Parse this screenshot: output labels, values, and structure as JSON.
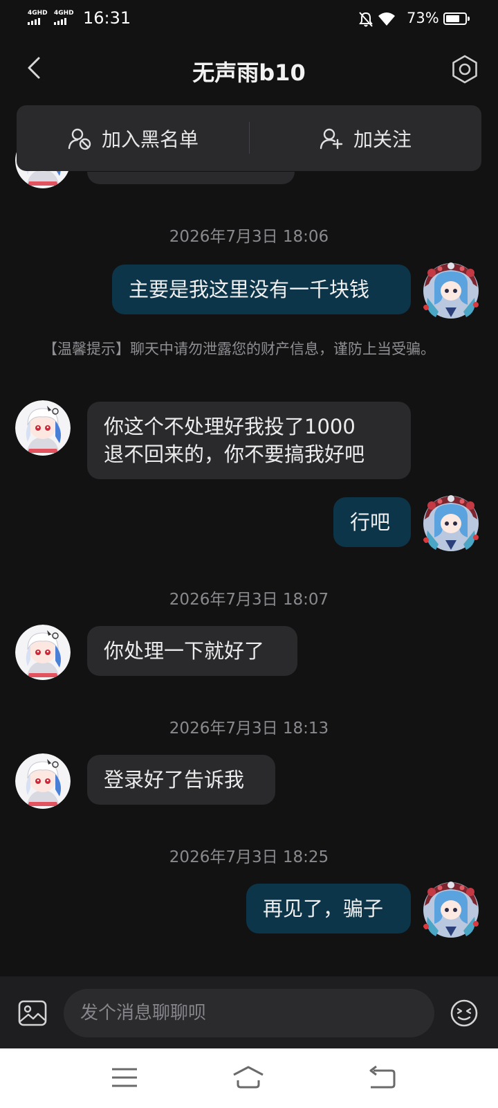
{
  "status_bar": {
    "network_1": "4GHD",
    "network_2": "4GHD",
    "time": "16:31",
    "battery_percent": "73%",
    "battery_level": 0.73,
    "icons": [
      "mute-icon",
      "wifi-icon",
      "battery-icon"
    ]
  },
  "header": {
    "title": "无声雨b10",
    "icons": [
      "back-arrow-icon",
      "settings-hexagon-icon"
    ]
  },
  "actions": {
    "blacklist_label": "加入黑名单",
    "follow_label": "加关注",
    "icons": [
      "user-block-icon",
      "user-add-icon"
    ]
  },
  "messages": [
    {
      "type": "timestamp",
      "text": "2026年7月3日 18:06"
    },
    {
      "type": "outgoing",
      "text": "主要是我这里没有一千块钱"
    },
    {
      "type": "tip",
      "text": "【温馨提示】聊天中请勿泄露您的财产信息，谨防上当受骗。"
    },
    {
      "type": "incoming",
      "text": "你这个不处理好我投了1000\n退不回来的，你不要搞我好吧"
    },
    {
      "type": "outgoing",
      "text": "行吧"
    },
    {
      "type": "timestamp",
      "text": "2026年7月3日 18:07"
    },
    {
      "type": "incoming",
      "text": "你处理一下就好了"
    },
    {
      "type": "timestamp",
      "text": "2026年7月3日 18:13"
    },
    {
      "type": "incoming",
      "text": "登录好了告诉我"
    },
    {
      "type": "timestamp",
      "text": "2026年7月3日 18:25"
    },
    {
      "type": "outgoing",
      "text": "再见了，骗子"
    }
  ],
  "input": {
    "placeholder": "发个消息聊聊呗",
    "value": "",
    "icons": [
      "image-icon",
      "emoji-icon"
    ]
  },
  "nav_bar": {
    "icons": [
      "menu-icon",
      "home-icon",
      "back-icon"
    ]
  },
  "colors": {
    "background": "#121212",
    "incoming_bubble": "#2a2a2d",
    "outgoing_bubble": "#0d3549",
    "timestamp_text": "#8a8a8e"
  }
}
